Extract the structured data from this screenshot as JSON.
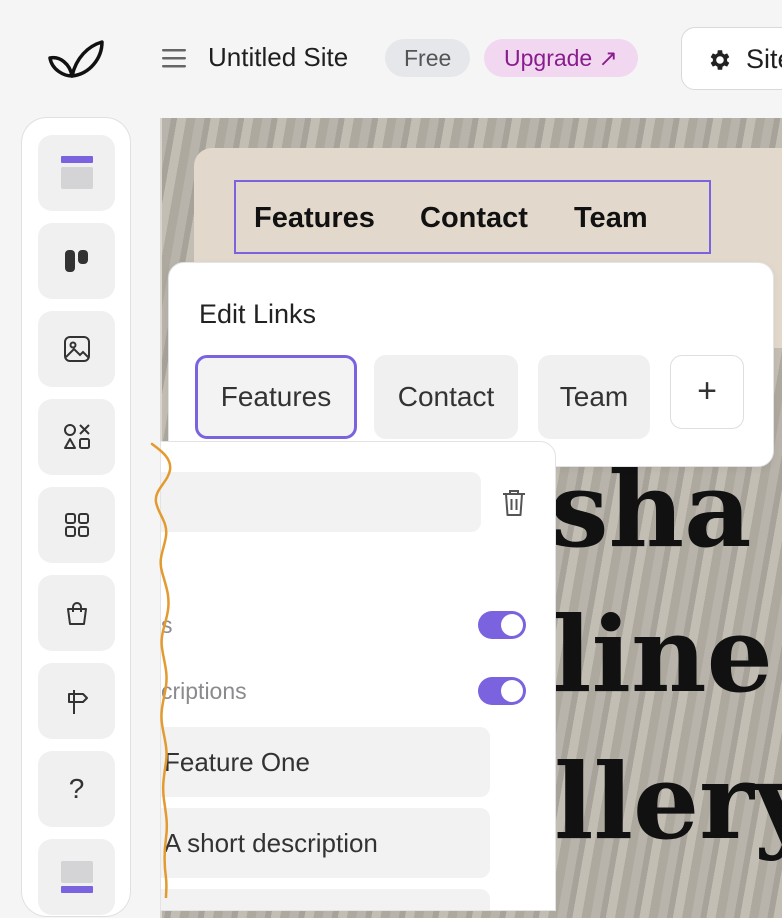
{
  "topbar": {
    "logo": "leaf-logo",
    "menu_icon": "hamburger-menu-icon",
    "site_title": "Untitled Site",
    "plan_badge": "Free",
    "upgrade_label": "Upgrade ↗",
    "site_button_label": "Site",
    "site_button_icon": "gear-icon"
  },
  "sidebar": {
    "tools": [
      {
        "icon": "header-block-icon"
      },
      {
        "icon": "columns-block-icon"
      },
      {
        "icon": "image-icon"
      },
      {
        "icon": "shapes-icon"
      },
      {
        "icon": "grid-icon"
      },
      {
        "icon": "shopping-bag-icon"
      },
      {
        "icon": "signpost-icon"
      },
      {
        "icon": "help-icon",
        "glyph": "?"
      },
      {
        "icon": "footer-block-icon"
      }
    ]
  },
  "canvas": {
    "nav_links": [
      "Features",
      "Contact",
      "Team"
    ],
    "hero_lines": [
      "sha",
      "line",
      "llery"
    ],
    "accent_color": "#7b63e0"
  },
  "edit_links": {
    "title": "Edit Links",
    "links": [
      "Features",
      "Contact",
      "Team"
    ],
    "add_glyph": "+",
    "selected": "Features"
  },
  "link_panel": {
    "toggle_1_label": "s",
    "toggle_1_on": true,
    "toggle_2_label": "criptions",
    "toggle_2_on": true,
    "feature_title": "Feature One",
    "feature_description": "A short description"
  }
}
